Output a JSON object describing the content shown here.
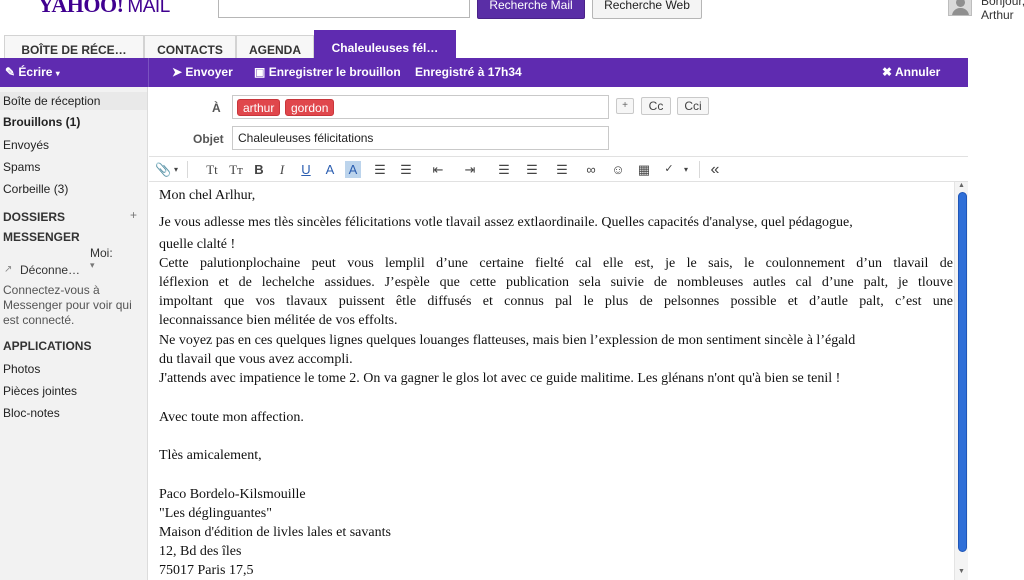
{
  "header": {
    "logo_brand": "YAHOO!",
    "logo_product": "MAIL",
    "search_mail_label": "Recherche Mail",
    "search_web_label": "Recherche Web",
    "greeting_line1": "Bonjour,",
    "greeting_line2": "Arthur"
  },
  "tabs": [
    {
      "label": "BOÎTE DE RÉCE…"
    },
    {
      "label": "CONTACTS"
    },
    {
      "label": "AGENDA"
    },
    {
      "label": "Chaleuleuses fél…"
    }
  ],
  "actionbar": {
    "compose_label": "Écrire",
    "send_label": "Envoyer",
    "draft_label": "Enregistrer le brouillon",
    "saved_status": "Enregistré à 17h34",
    "cancel_label": "Annuler"
  },
  "sidebar": {
    "items": [
      {
        "label": "Boîte de réception"
      },
      {
        "label": "Brouillons (1)"
      },
      {
        "label": "Envoyés"
      },
      {
        "label": "Spams"
      },
      {
        "label": "Corbeille (3)"
      }
    ],
    "folders_heading": "DOSSIERS",
    "messenger_heading": "MESSENGER",
    "messenger_me": "Moi:",
    "messenger_status": "Déconne…",
    "messenger_connect": "Connectez-vous à Messenger pour voir qui est connecté.",
    "apps_heading": "APPLICATIONS",
    "apps": [
      {
        "label": "Photos"
      },
      {
        "label": "Pièces jointes"
      },
      {
        "label": "Bloc-notes"
      }
    ]
  },
  "compose": {
    "to_label": "À",
    "recipients": [
      "arthur",
      "gordon"
    ],
    "plus_label": "+",
    "cc_label": "Cc",
    "cci_label": "Cci",
    "subject_label": "Objet",
    "subject_value": "Chaleuleuses félicitations"
  },
  "toolbar": {
    "text_size": "Tt",
    "text_style": "Tт",
    "bold": "B",
    "italic": "I",
    "underline": "U",
    "text_color": "A",
    "highlight": "A",
    "collapse": "«"
  },
  "body": {
    "lines": [
      "Mon chel Arlhur,",
      "Je vous adlesse mes tlès sincèles félicitations votle tlavail assez extlaordinaile. Quelles capacités d'analyse, quel pédagogue,",
      "quelle clalté !",
      "Cette palutionplochaine peut vous lemplil d’une certaine fielté cal elle est, je le sais, le coulonnement d’un tlavail de",
      "léflexion et de lechelche assidues. J’espèle que cette publication sela suivie de nombleuses autles cal d’une palt, je tlouve",
      "impoltant que vos tlavaux puissent êtle diffusés et connus pal le plus de pelsonnes possible et d’autle palt, c’est une",
      "leconnaissance bien mélitée de vos effolts.",
      "Ne voyez pas en ces quelques lignes quelques louanges flatteuses, mais bien l’explession de mon sentiment sincèle à l’égald",
      "du tlavail que vous avez accompli.",
      "J'attends avec impatience le tome 2. On va gagner le glos lot avec ce guide malitime. Les glénans n'ont qu'à bien se tenil !",
      "Avec toute mon affection.",
      "Tlès amicalement,",
      "Paco Bordelo-Kilsmouille",
      "\"Les déglinguantes\"",
      "Maison d'édition de livles lales et savants",
      "12, Bd des îles",
      "75017 Paris 17,5"
    ]
  },
  "colors": {
    "accent": "#5f2bb0",
    "recipient_chip": "#e0474c",
    "scrollbar": "#2f6fd8"
  }
}
